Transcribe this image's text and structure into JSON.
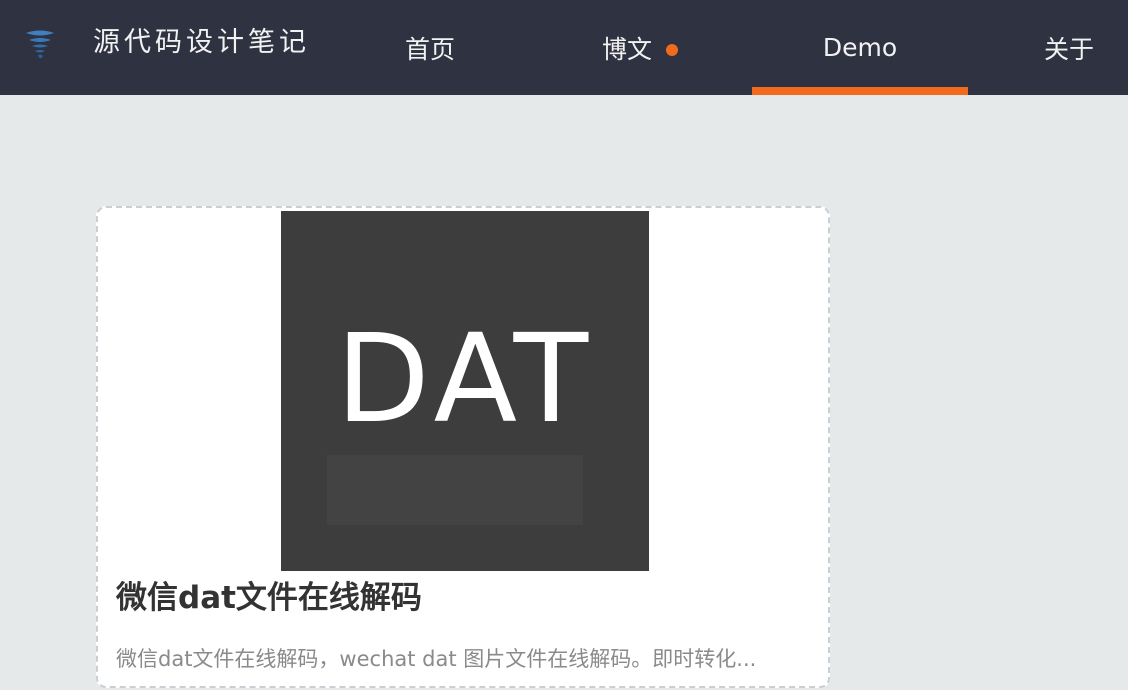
{
  "header": {
    "site_title": "源代码设计笔记",
    "logo_icon": "tornado-logo-icon",
    "nav": {
      "home": "首页",
      "blog": "博文",
      "demo": "Demo",
      "about": "关于"
    },
    "active_tab": "Demo",
    "accent_color": "#f26b1d"
  },
  "card": {
    "thumbnail_text": "DAT",
    "title": "微信dat文件在线解码",
    "description": "微信dat文件在线解码，wechat dat 图片文件在线解码。即时转化..."
  }
}
